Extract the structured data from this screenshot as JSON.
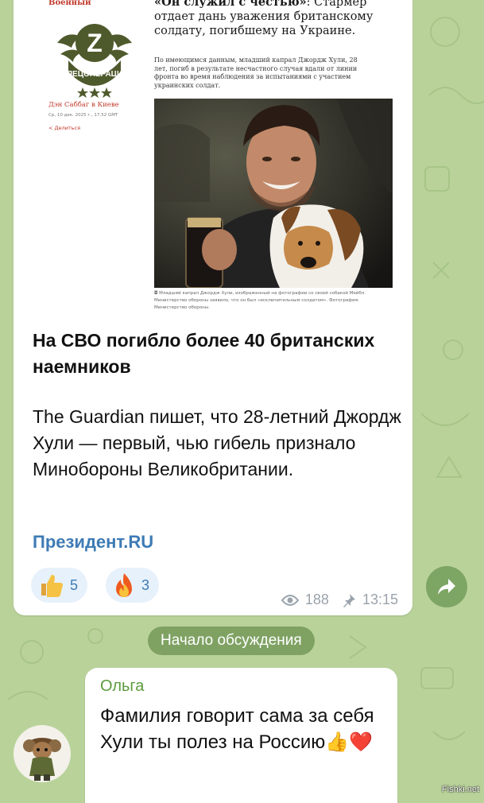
{
  "post": {
    "article": {
      "section_label": "Военный",
      "logo_alt": "Z СПЕЦОПЕРАЦИЯ",
      "byline": "Дэн Саббаг в Киеве",
      "date": "Ср, 10 дек. 2025 г., 17.52 GMT",
      "share_label": "Делиться",
      "headline_quote": "«Он служил с честью»",
      "headline_rest": ": Стармер отдает дань уважения британскому солдату, погибшему на Украине.",
      "lede": "По имеющимся данным, младший капрал Джордж Хули, 28 лет, погиб в результате несчастного случая вдали от линии фронта во время наблюдения за испытаниями с участием украинских солдат.",
      "photo_caption": "Младший капрал Джордж Хули, изображенный на фотографии со своей собакой Мейбл. Министерство обороны заявило, что он был «исключительным солдатом». Фотография: Министерство обороны."
    },
    "headline": "На СВО погибло более 40 британских наемников",
    "body": "The Guardian пишет, что 28-летний Джордж Хули — первый, чью гибель признало Минобороны Великобритании.",
    "source": "Президент.RU",
    "reactions": [
      {
        "icon": "thumbs-up-icon",
        "count": "5"
      },
      {
        "icon": "fire-icon",
        "count": "3"
      }
    ],
    "views": "188",
    "time": "13:15"
  },
  "discussion_label": "Начало обсуждения",
  "comment": {
    "author": "Ольга",
    "text": "Фамилия говорит сама за себя Хули ты полез на Россию",
    "emoji": "👍❤️"
  },
  "watermark": "Fishki.net",
  "colors": {
    "chat_background": "#b9d29a",
    "link_blue": "#3d7bb5",
    "author_green": "#5c9b3d",
    "pill_green": "#7fa263",
    "article_red": "#c0392b"
  }
}
